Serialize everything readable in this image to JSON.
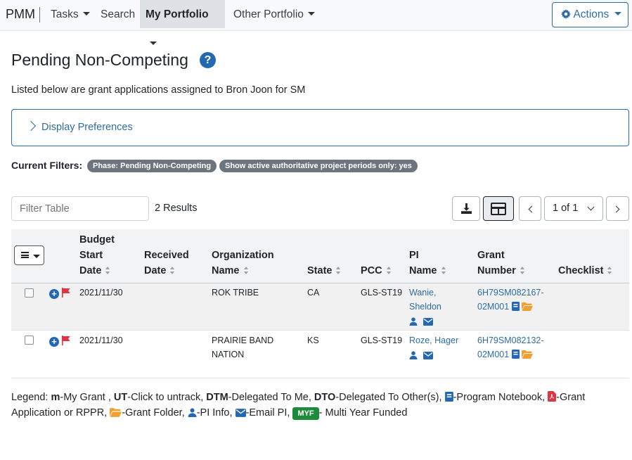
{
  "nav": {
    "brand": "PMM",
    "items": [
      "Tasks",
      "Search",
      "My Portfolio",
      "Other Portfolio"
    ],
    "actions_label": "Actions"
  },
  "page": {
    "title": "Pending Non-Competing",
    "subtitle": "Listed below are grant applications assigned to Bron Joon for SM",
    "display_preferences": "Display Preferences"
  },
  "filters": {
    "label": "Current Filters:",
    "badges": [
      "Phase: Pending Non-Competing",
      "Show active authoritative project periods only: yes"
    ]
  },
  "toolbar": {
    "filter_placeholder": "Filter Table",
    "results": "2 Results",
    "pagination": "1 of 1"
  },
  "table": {
    "headers": {
      "budget": [
        "Budget",
        "Start",
        "Date"
      ],
      "received": [
        "Received",
        "Date"
      ],
      "org": [
        "Organization",
        "Name"
      ],
      "state": "State",
      "pcc": "PCC",
      "pi": [
        "PI",
        "Name"
      ],
      "grant": [
        "Grant",
        "Number"
      ],
      "checklist": "Checklist"
    },
    "rows": [
      {
        "budget_start": "2021/11/30",
        "received": "",
        "org": [
          "ROK TRIBE"
        ],
        "state": "CA",
        "pcc": "GLS-ST19",
        "pi": [
          "Wanie,",
          "Sheldon"
        ],
        "grant": [
          "6H79SM082167-",
          "02M001"
        ]
      },
      {
        "budget_start": "2021/11/30",
        "received": "",
        "org": [
          "PRAIRIE BAND",
          "NATION"
        ],
        "state": "KS",
        "pcc": "GLS-ST19",
        "pi": [
          "Roze, Hager"
        ],
        "grant": [
          "6H79SM082132-",
          "02M001"
        ]
      }
    ]
  },
  "legend": {
    "prefix": "Legend: ",
    "m_key": "m",
    "m_text": "-My Grant , ",
    "ut_key": "UT",
    "ut_text": "-Click to untrack, ",
    "dtm_key": "DTM",
    "dtm_text": "-Delegated To Me, ",
    "dto_key": "DTO",
    "dto_text": "-Delegated To Other(s), ",
    "notebook_text": "-Program Notebook, ",
    "pdf_text": "-Grant Application or RPPR, ",
    "folder_text": "-Grant Folder, ",
    "pi_text": "-PI Info, ",
    "email_text": "-Email PI, ",
    "myf_badge": "MYF",
    "myf_text": "- Multi Year Funded"
  },
  "colors": {
    "primary": "#2e6da4",
    "badge_gray": "#6c757d",
    "flag_red": "#dc3545",
    "folder_orange": "#f0a030",
    "myf_green": "#1e8a3c"
  }
}
